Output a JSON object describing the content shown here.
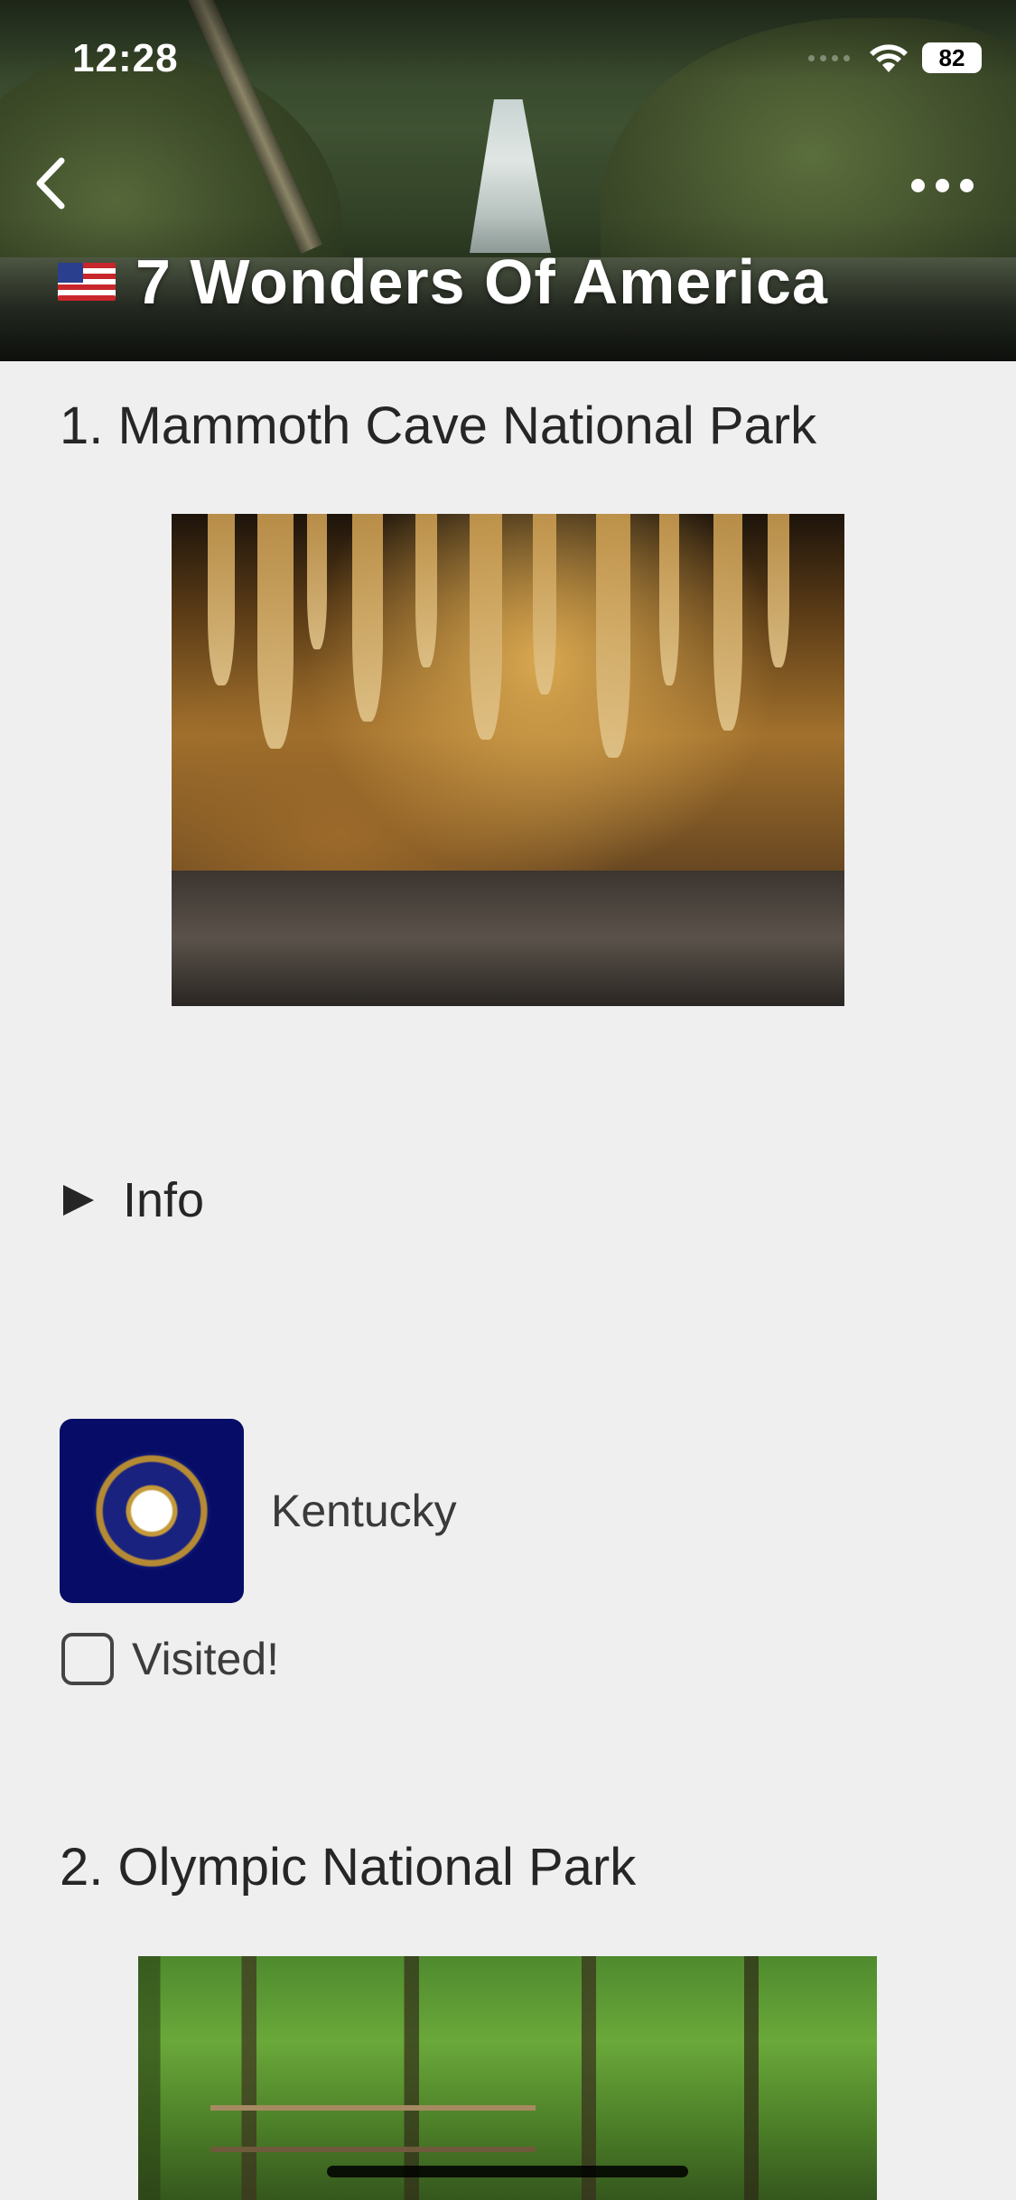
{
  "status_bar": {
    "time": "12:28",
    "battery": "82"
  },
  "header": {
    "title": "7 Wonders Of America"
  },
  "sections": [
    {
      "title": "1. Mammoth Cave National Park",
      "info_label": "Info",
      "state": "Kentucky",
      "visited_label": "Visited!",
      "visited_checked": false
    },
    {
      "title": "2. Olympic National Park"
    }
  ],
  "icons": [
    "back-icon",
    "more-icon",
    "us-flag-icon",
    "wifi-icon",
    "battery-icon",
    "disclosure-triangle-icon",
    "kentucky-flag-icon",
    "checkbox-icon"
  ]
}
